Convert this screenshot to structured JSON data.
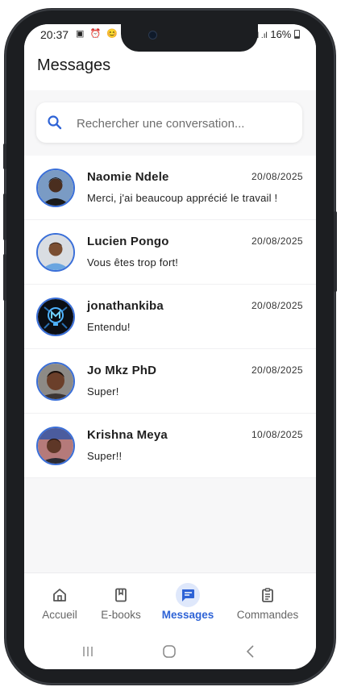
{
  "status_bar": {
    "time": "20:37",
    "left_icons": "▣ ⏰ 😊",
    "signal": "⁴ᴳ .ıl .ıl",
    "battery": "16%"
  },
  "header": {
    "title": "Messages"
  },
  "search": {
    "placeholder": "Rechercher une conversation..."
  },
  "conversations": [
    {
      "name": "Naomie Ndele",
      "date": "20/08/2025",
      "message": "Merci, j'ai beaucoup apprécié le travail !"
    },
    {
      "name": "Lucien Pongo",
      "date": "20/08/2025",
      "message": "Vous êtes trop fort!"
    },
    {
      "name": "jonathankiba",
      "date": "20/08/2025",
      "message": "Entendu!"
    },
    {
      "name": "Jo Mkz PhD",
      "date": "20/08/2025",
      "message": "Super!"
    },
    {
      "name": "Krishna Meya",
      "date": "10/08/2025",
      "message": "Super!!"
    }
  ],
  "bottom_nav": {
    "items": [
      {
        "label": "Accueil",
        "icon": "home-icon",
        "active": false
      },
      {
        "label": "E-books",
        "icon": "book-icon",
        "active": false
      },
      {
        "label": "Messages",
        "icon": "message-icon",
        "active": true
      },
      {
        "label": "Commandes",
        "icon": "clipboard-icon",
        "active": false
      }
    ]
  },
  "system_nav": {
    "icons": [
      "recents-icon",
      "home-circle-icon",
      "back-icon"
    ]
  },
  "colors": {
    "accent": "#2e63d6",
    "avatar_border": "#3a6fd8",
    "background": "#f7f7f8"
  }
}
